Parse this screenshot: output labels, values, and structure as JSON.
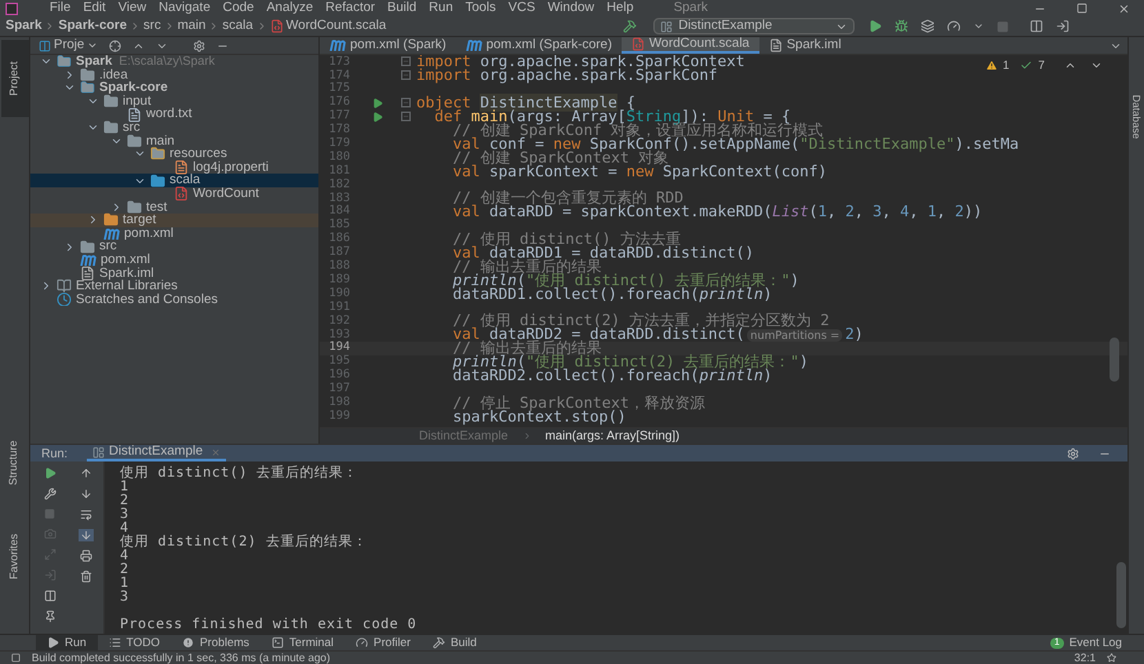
{
  "menu": {
    "items": [
      "File",
      "Edit",
      "View",
      "Navigate",
      "Code",
      "Analyze",
      "Refactor",
      "Build",
      "Run",
      "Tools",
      "VCS",
      "Window",
      "Help"
    ],
    "title": "Spark"
  },
  "navbar": {
    "crumbs": [
      {
        "label": "Spark",
        "kind": "module"
      },
      {
        "label": "Spark-core",
        "kind": "module"
      },
      {
        "label": "src",
        "kind": "dir"
      },
      {
        "label": "main",
        "kind": "dir"
      },
      {
        "label": "scala",
        "kind": "dir"
      },
      {
        "label": "WordCount.scala",
        "kind": "file"
      }
    ],
    "run_config": "DistinctExample"
  },
  "left_stripe": {
    "top": [
      {
        "label": "Project",
        "selected": true
      }
    ],
    "bottom": [
      {
        "label": "Structure",
        "selected": false
      },
      {
        "label": "Favorites",
        "selected": false
      }
    ]
  },
  "project": {
    "title": "Proje",
    "tree": [
      {
        "label": "Spark",
        "path": "E:\\scala\\zy\\Spark",
        "kind": "module",
        "expanded": true,
        "selected": false,
        "children": [
          {
            "label": ".idea",
            "kind": "folder",
            "expanded": false,
            "selected": false
          },
          {
            "label": "Spark-core",
            "kind": "module",
            "expanded": true,
            "selected": false,
            "children": [
              {
                "label": "input",
                "kind": "folder",
                "expanded": true,
                "selected": false,
                "children": [
                  {
                    "label": "word.txt",
                    "kind": "text",
                    "selected": false
                  }
                ]
              },
              {
                "label": "src",
                "kind": "folder",
                "expanded": true,
                "selected": false,
                "children": [
                  {
                    "label": "main",
                    "kind": "folder",
                    "expanded": true,
                    "selected": false,
                    "children": [
                      {
                        "label": "resources",
                        "kind": "resources",
                        "expanded": true,
                        "selected": false,
                        "children": [
                          {
                            "label": "log4j.properti",
                            "kind": "properties",
                            "selected": false
                          }
                        ]
                      },
                      {
                        "label": "scala",
                        "kind": "source",
                        "expanded": true,
                        "selected": true,
                        "children": [
                          {
                            "label": "WordCount",
                            "kind": "scala",
                            "selected": false
                          }
                        ]
                      }
                    ]
                  },
                  {
                    "label": "test",
                    "kind": "folder",
                    "expanded": false,
                    "selected": false
                  }
                ]
              },
              {
                "label": "target",
                "kind": "excluded",
                "expanded": false,
                "selected": false
              },
              {
                "label": "pom.xml",
                "kind": "maven",
                "selected": false
              }
            ]
          },
          {
            "label": "src",
            "kind": "folder",
            "expanded": false,
            "selected": false
          },
          {
            "label": "pom.xml",
            "kind": "maven",
            "selected": false
          },
          {
            "label": "Spark.iml",
            "kind": "iml",
            "selected": false
          }
        ]
      },
      {
        "label": "External Libraries",
        "kind": "libraries",
        "expanded": false,
        "selected": false
      },
      {
        "label": "Scratches and Consoles",
        "kind": "scratches",
        "selected": false
      }
    ]
  },
  "tabs": [
    {
      "label": "pom.xml (Spark)",
      "kind": "maven",
      "selected": false
    },
    {
      "label": "pom.xml (Spark-core)",
      "kind": "maven",
      "selected": false
    },
    {
      "label": "WordCount.scala",
      "kind": "scala",
      "selected": true
    },
    {
      "label": "Spark.iml",
      "kind": "iml",
      "selected": false
    }
  ],
  "editor": {
    "warnings": "1",
    "passed": "7",
    "lines": [
      {
        "number": "173",
        "run": false,
        "fold": true,
        "current": false,
        "tokens": [
          {
            "kind": "kw",
            "text": "import"
          },
          {
            "kind": "text",
            "text": " org.apache.spark.SparkContext"
          }
        ]
      },
      {
        "number": "174",
        "run": false,
        "fold": true,
        "current": false,
        "tokens": [
          {
            "kind": "kw",
            "text": "import"
          },
          {
            "kind": "text",
            "text": " org.apache.spark.SparkConf"
          }
        ]
      },
      {
        "number": "175",
        "run": false,
        "fold": false,
        "current": false
      },
      {
        "number": "176",
        "run": true,
        "fold": true,
        "current": false,
        "tokens": [
          {
            "kind": "kw",
            "text": "object "
          },
          {
            "kind": "decl",
            "text": "DistinctExample"
          },
          {
            "kind": "text",
            "text": " {"
          }
        ]
      },
      {
        "number": "177",
        "run": true,
        "fold": true,
        "current": false,
        "tokens": [
          {
            "kind": "kw",
            "text": "  def "
          },
          {
            "kind": "fn",
            "text": "main"
          },
          {
            "kind": "text",
            "text": "(args: Array["
          },
          {
            "kind": "type",
            "text": "String"
          },
          {
            "kind": "text",
            "text": "]): "
          },
          {
            "kind": "kw",
            "text": "Unit"
          },
          {
            "kind": "text",
            "text": " = {"
          }
        ]
      },
      {
        "number": "178",
        "run": false,
        "fold": false,
        "current": false,
        "tokens": [
          {
            "kind": "comment",
            "text": "    // 创建 SparkConf 对象，设置应用名称和运行模式"
          }
        ]
      },
      {
        "number": "179",
        "run": false,
        "fold": false,
        "current": false,
        "tokens": [
          {
            "kind": "kw",
            "text": "    val"
          },
          {
            "kind": "text",
            "text": " conf = "
          },
          {
            "kind": "kw",
            "text": "new"
          },
          {
            "kind": "text",
            "text": " SparkConf().setAppName("
          },
          {
            "kind": "string",
            "text": "\"DistinctExample\""
          },
          {
            "kind": "text",
            "text": ").setMa"
          }
        ]
      },
      {
        "number": "180",
        "run": false,
        "fold": false,
        "current": false,
        "tokens": [
          {
            "kind": "comment",
            "text": "    // 创建 SparkContext 对象"
          }
        ]
      },
      {
        "number": "181",
        "run": false,
        "fold": false,
        "current": false,
        "tokens": [
          {
            "kind": "kw",
            "text": "    val"
          },
          {
            "kind": "text",
            "text": " sparkContext = "
          },
          {
            "kind": "kw",
            "text": "new"
          },
          {
            "kind": "text",
            "text": " SparkContext(conf)"
          }
        ]
      },
      {
        "number": "182",
        "run": false,
        "fold": false,
        "current": false
      },
      {
        "number": "183",
        "run": false,
        "fold": false,
        "current": false,
        "tokens": [
          {
            "kind": "comment",
            "text": "    // 创建一个包含重复元素的 RDD"
          }
        ]
      },
      {
        "number": "184",
        "run": false,
        "fold": false,
        "current": false,
        "tokens": [
          {
            "kind": "kw",
            "text": "    val"
          },
          {
            "kind": "text",
            "text": " dataRDD = sparkContext.makeRDD("
          },
          {
            "kind": "const",
            "text": "List"
          },
          {
            "kind": "text",
            "text": "("
          },
          {
            "kind": "number",
            "text": "1"
          },
          {
            "kind": "text",
            "text": ", "
          },
          {
            "kind": "number",
            "text": "2"
          },
          {
            "kind": "text",
            "text": ", "
          },
          {
            "kind": "number",
            "text": "3"
          },
          {
            "kind": "text",
            "text": ", "
          },
          {
            "kind": "number",
            "text": "4"
          },
          {
            "kind": "text",
            "text": ", "
          },
          {
            "kind": "number",
            "text": "1"
          },
          {
            "kind": "text",
            "text": ", "
          },
          {
            "kind": "number",
            "text": "2"
          },
          {
            "kind": "text",
            "text": "))"
          }
        ]
      },
      {
        "number": "185",
        "run": false,
        "fold": false,
        "current": false
      },
      {
        "number": "186",
        "run": false,
        "fold": false,
        "current": false,
        "tokens": [
          {
            "kind": "comment",
            "text": "    // 使用 distinct() 方法去重"
          }
        ]
      },
      {
        "number": "187",
        "run": false,
        "fold": false,
        "current": false,
        "tokens": [
          {
            "kind": "kw",
            "text": "    val"
          },
          {
            "kind": "text",
            "text": " dataRDD1 = dataRDD.distinct()"
          }
        ]
      },
      {
        "number": "188",
        "run": false,
        "fold": false,
        "current": false,
        "tokens": [
          {
            "kind": "comment",
            "text": "    // 输出去重后的结果"
          }
        ]
      },
      {
        "number": "189",
        "run": false,
        "fold": false,
        "current": false,
        "tokens": [
          {
            "kind": "call",
            "text": "    println"
          },
          {
            "kind": "text",
            "text": "("
          },
          {
            "kind": "string",
            "text": "\"使用 distinct() 去重后的结果：\""
          },
          {
            "kind": "text",
            "text": ")"
          }
        ]
      },
      {
        "number": "190",
        "run": false,
        "fold": false,
        "current": false,
        "tokens": [
          {
            "kind": "text",
            "text": "    dataRDD1.collect().foreach("
          },
          {
            "kind": "call",
            "text": "println"
          },
          {
            "kind": "text",
            "text": ")"
          }
        ]
      },
      {
        "number": "191",
        "run": false,
        "fold": false,
        "current": false
      },
      {
        "number": "192",
        "run": false,
        "fold": false,
        "current": false,
        "tokens": [
          {
            "kind": "comment",
            "text": "    // 使用 distinct(2) 方法去重，并指定分区数为 2"
          }
        ]
      },
      {
        "number": "193",
        "run": false,
        "fold": false,
        "current": false,
        "tokens": [
          {
            "kind": "kw",
            "text": "    val"
          },
          {
            "kind": "text",
            "text": " dataRDD2 = dataRDD.distinct("
          },
          {
            "kind": "hint",
            "text": "numPartitions ="
          },
          {
            "kind": "number",
            "text": "2"
          },
          {
            "kind": "text",
            "text": ")"
          }
        ]
      },
      {
        "number": "194",
        "run": false,
        "fold": false,
        "current": true,
        "tokens": [
          {
            "kind": "comment",
            "text": "    // 输出去重后的结果"
          }
        ]
      },
      {
        "number": "195",
        "run": false,
        "fold": false,
        "current": false,
        "tokens": [
          {
            "kind": "call",
            "text": "    println"
          },
          {
            "kind": "text",
            "text": "("
          },
          {
            "kind": "string",
            "text": "\"使用 distinct(2) 去重后的结果：\""
          },
          {
            "kind": "text",
            "text": ")"
          }
        ]
      },
      {
        "number": "196",
        "run": false,
        "fold": false,
        "current": false,
        "tokens": [
          {
            "kind": "text",
            "text": "    dataRDD2.collect().foreach("
          },
          {
            "kind": "call",
            "text": "println"
          },
          {
            "kind": "text",
            "text": ")"
          }
        ]
      },
      {
        "number": "197",
        "run": false,
        "fold": false,
        "current": false
      },
      {
        "number": "198",
        "run": false,
        "fold": false,
        "current": false,
        "tokens": [
          {
            "kind": "comment",
            "text": "    // 停止 SparkContext，释放资源"
          }
        ]
      },
      {
        "number": "199",
        "run": false,
        "fold": false,
        "current": false,
        "tokens": [
          {
            "kind": "text",
            "text": "    sparkContext.stop()"
          }
        ]
      }
    ],
    "breadcrumb": [
      "DistinctExample",
      "main(args: Array[String])"
    ]
  },
  "right_stripe": [
    "Database"
  ],
  "run": {
    "label": "Run:",
    "tab": "DistinctExample",
    "output": [
      "使用 distinct() 去重后的结果：",
      "1",
      "2",
      "3",
      "4",
      "使用 distinct(2) 去重后的结果：",
      "4",
      "2",
      "1",
      "3"
    ],
    "exit_message": "Process finished with exit code 0"
  },
  "bottom_tabs": [
    {
      "label": "Run",
      "kind": "run",
      "selected": true
    },
    {
      "label": "TODO",
      "kind": "todo",
      "selected": false
    },
    {
      "label": "Problems",
      "kind": "problems",
      "selected": false
    },
    {
      "label": "Terminal",
      "kind": "terminal",
      "selected": false
    },
    {
      "label": "Profiler",
      "kind": "profiler",
      "selected": false
    },
    {
      "label": "Build",
      "kind": "build",
      "selected": false
    }
  ],
  "event_log": {
    "label": "Event Log",
    "count": "1"
  },
  "status": {
    "message": "Build completed successfully in 1 sec, 336 ms (a minute ago)",
    "position": "32:1"
  }
}
